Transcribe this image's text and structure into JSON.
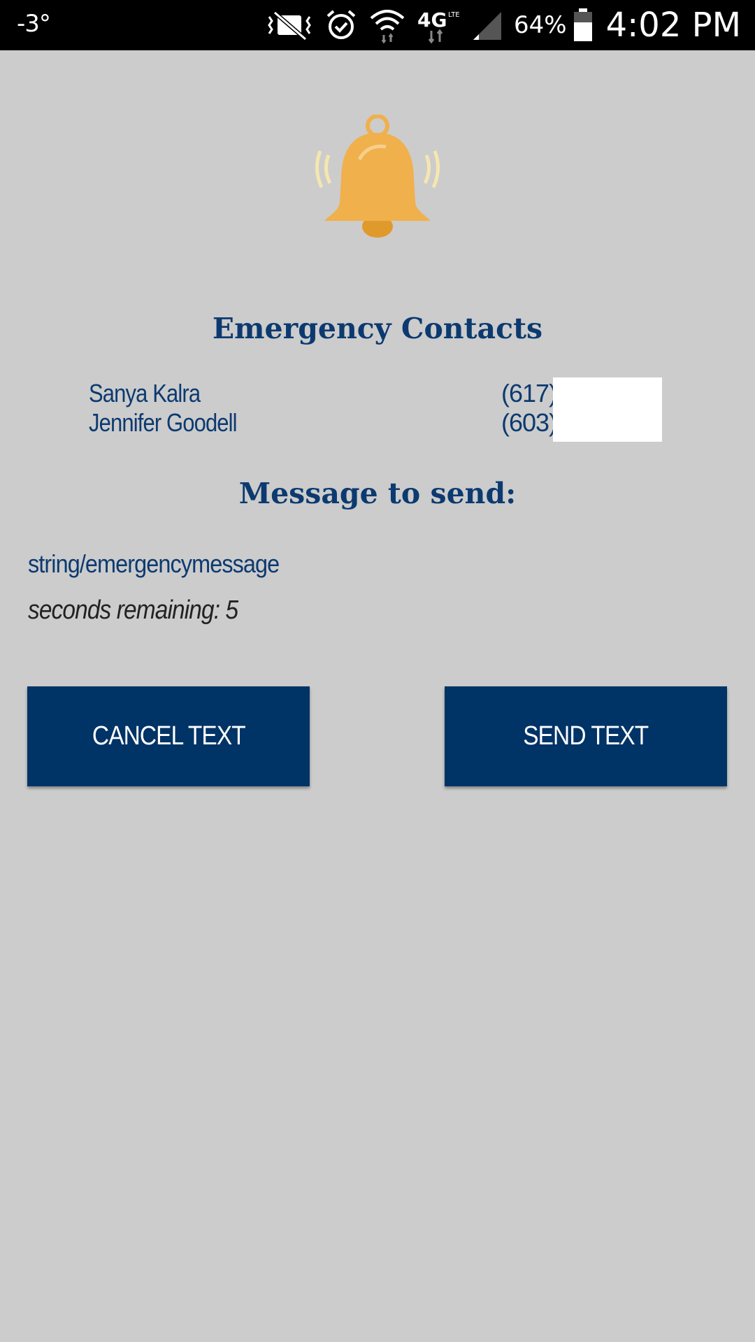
{
  "status_bar": {
    "temperature": "-3°",
    "battery_percent": "64%",
    "time": "4:02 PM",
    "network": "4G",
    "icons": [
      "vibrate-mute-icon",
      "alarm-icon",
      "wifi-icon",
      "4g-lte-icon",
      "signal-icon",
      "battery-icon"
    ]
  },
  "header_icon": "bell-icon",
  "contacts_section": {
    "title": "Emergency Contacts",
    "contacts": [
      {
        "name": "Sanya Kalra",
        "phone": "(617)"
      },
      {
        "name": "Jennifer Goodell",
        "phone": "(603)"
      }
    ]
  },
  "message_section": {
    "title": "Message to send:",
    "body": "string/emergencymessage",
    "countdown": "seconds remaining: 5"
  },
  "buttons": {
    "cancel_label": "CANCEL TEXT",
    "send_label": "SEND TEXT"
  },
  "colors": {
    "background": "#cccccc",
    "primary": "#003366",
    "text": "#0c3a70",
    "bell": "#f0b04c"
  }
}
